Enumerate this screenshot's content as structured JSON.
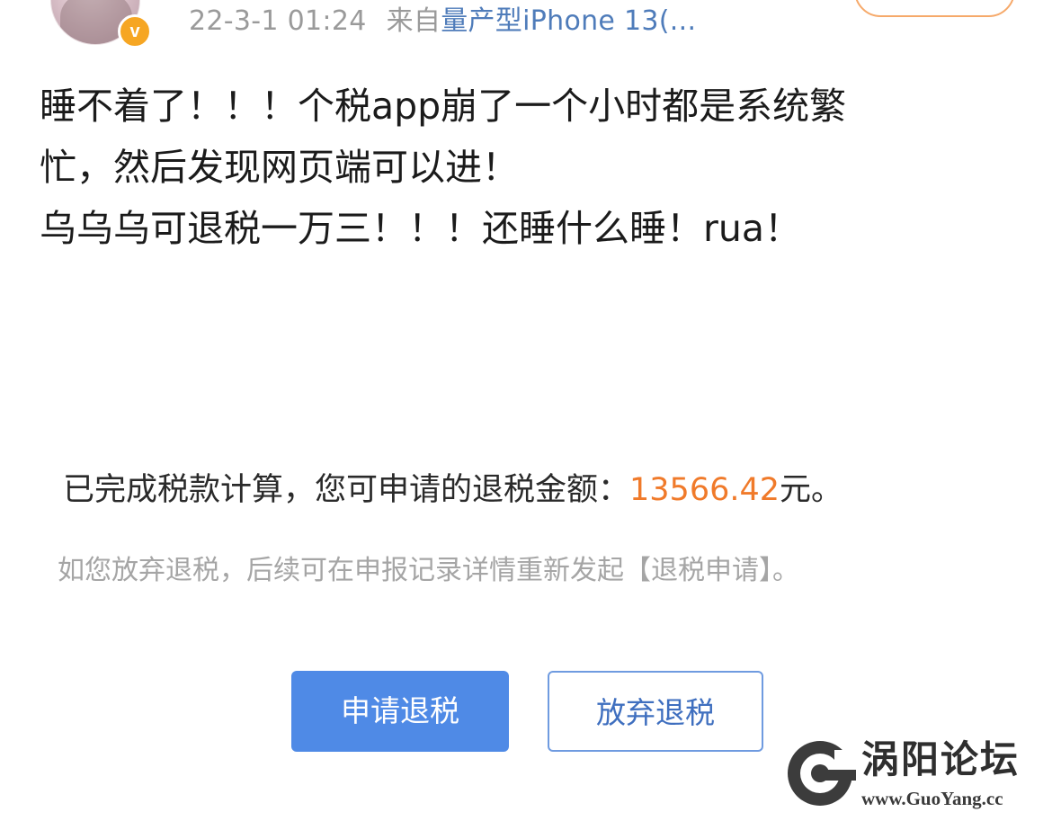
{
  "header": {
    "timestamp": "22-3-1 01:24",
    "source_prefix": "来自",
    "device": "量产型iPhone 13(...",
    "verified_badge": "v"
  },
  "post": {
    "lines": [
      "睡不着了！！！个税app崩了一个小时都是系统繁",
      "忙，然后发现网页端可以进！",
      "乌乌乌可退税一万三！！！还睡什么睡！rua！"
    ]
  },
  "screenshot": {
    "result_prefix": "已完成税款计算，您可申请的退税金额：",
    "amount": "13566.42",
    "result_suffix": "元。",
    "hint": "如您放弃退税，后续可在申报记录详情重新发起【退税申请】。",
    "apply_button": "申请退税",
    "abandon_button": "放弃退税"
  },
  "watermark": {
    "name": "涡阳论坛",
    "url": "www.GuoYang.cc"
  },
  "colors": {
    "device_link": "#4f7cba",
    "amount": "#f07a2a",
    "apply_button_bg": "#4f8ae6",
    "abandon_button_border": "#6f9be0",
    "verified_badge": "#f6a623"
  }
}
